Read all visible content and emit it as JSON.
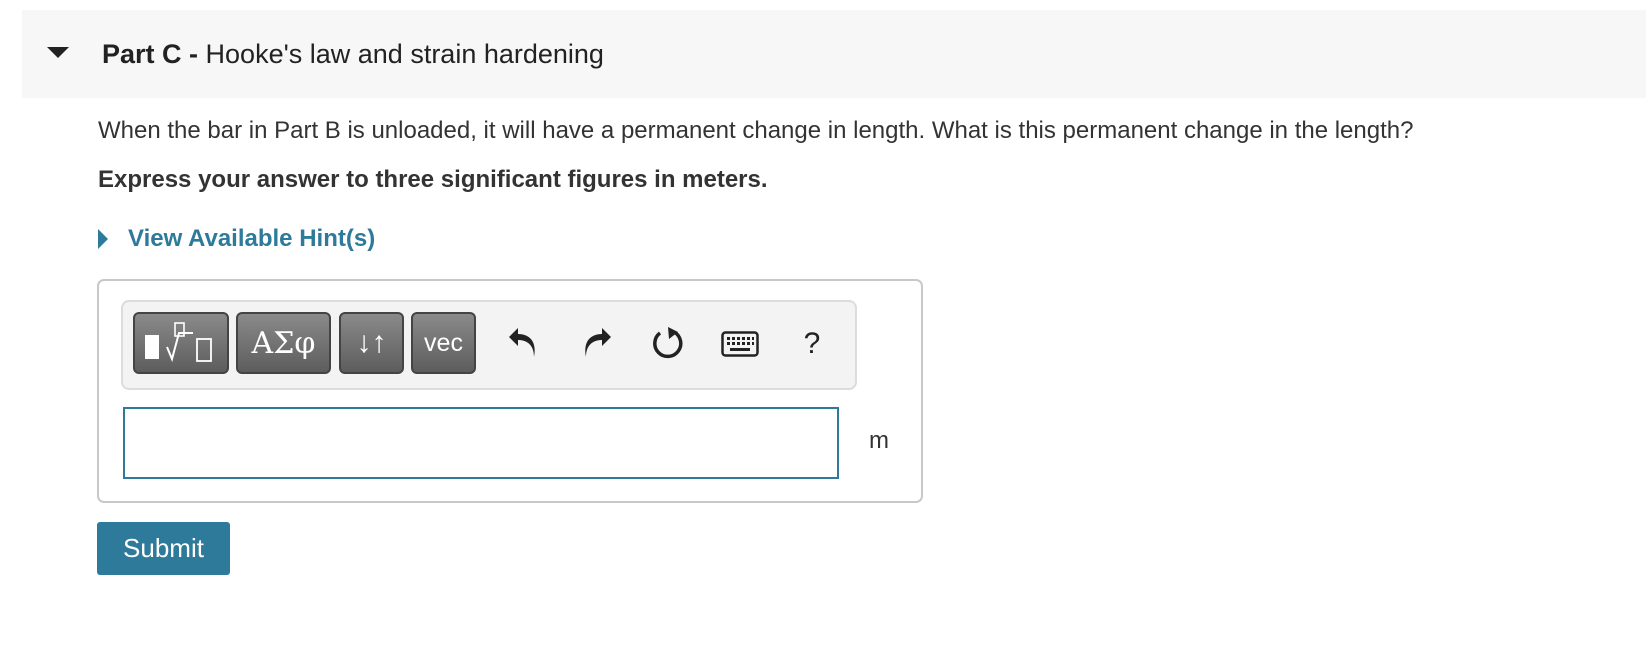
{
  "part": {
    "label": "Part C -",
    "title": "Hooke's law and strain hardening"
  },
  "question": {
    "text": "When the bar in Part B is unloaded, it will have a permanent change in length. What is this permanent change in the length?",
    "instruction": "Express your answer to three significant figures in meters."
  },
  "hint": {
    "label": "View Available Hint(s)"
  },
  "toolbar": {
    "greek_label": "ΑΣφ",
    "arrows_label": "↓↑",
    "vec_label": "vec",
    "help_label": "?",
    "icons": [
      "templates-icon",
      "undo-icon",
      "redo-icon",
      "reset-icon",
      "keyboard-icon",
      "help-icon"
    ]
  },
  "answer": {
    "value": "",
    "unit": "m"
  },
  "submit": {
    "label": "Submit"
  },
  "colors": {
    "accent": "#2e7a9b",
    "header_bg": "#f7f7f7",
    "text": "#333333"
  }
}
